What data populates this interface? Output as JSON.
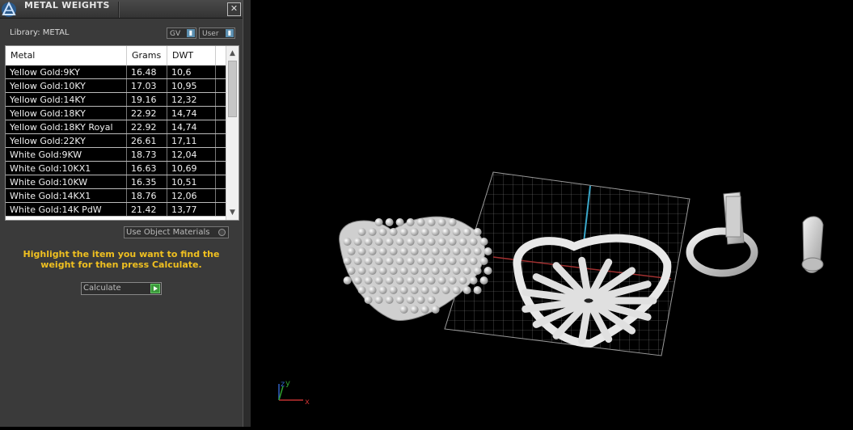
{
  "window": {
    "title": "METAL WEIGHTS"
  },
  "library": {
    "label": "Library: METAL",
    "gv_label": "GV",
    "user_label": "User"
  },
  "table": {
    "headers": [
      "Metal",
      "Grams",
      "DWT"
    ],
    "rows": [
      {
        "metal": "Yellow Gold:9KY",
        "grams": "16.48",
        "dwt": "10,6"
      },
      {
        "metal": "Yellow Gold:10KY",
        "grams": "17.03",
        "dwt": "10,95"
      },
      {
        "metal": "Yellow Gold:14KY",
        "grams": "19.16",
        "dwt": "12,32"
      },
      {
        "metal": "Yellow Gold:18KY",
        "grams": "22.92",
        "dwt": "14,74"
      },
      {
        "metal": "Yellow Gold:18KY Royal",
        "grams": "22.92",
        "dwt": "14,74"
      },
      {
        "metal": "Yellow Gold:22KY",
        "grams": "26.61",
        "dwt": "17,11"
      },
      {
        "metal": "White Gold:9KW",
        "grams": "18.73",
        "dwt": "12,04"
      },
      {
        "metal": "White Gold:10KX1",
        "grams": "16.63",
        "dwt": "10,69"
      },
      {
        "metal": "White Gold:10KW",
        "grams": "16.35",
        "dwt": "10,51"
      },
      {
        "metal": "White Gold:14KX1",
        "grams": "18.76",
        "dwt": "12,06"
      },
      {
        "metal": "White Gold:14K PdW",
        "grams": "21.42",
        "dwt": "13,77"
      }
    ]
  },
  "options": {
    "use_object_materials": "Use Object Materials"
  },
  "hint": "Highlight the item you want to find the weight for then press Calculate.",
  "calculate_label": "Calculate",
  "viewport": {
    "axis_x": "x",
    "axis_y": "y",
    "axis_z": "z"
  },
  "colors": {
    "hint": "#f0c020",
    "row_bg": "#000000",
    "panel_bg": "#3a3a3a"
  }
}
